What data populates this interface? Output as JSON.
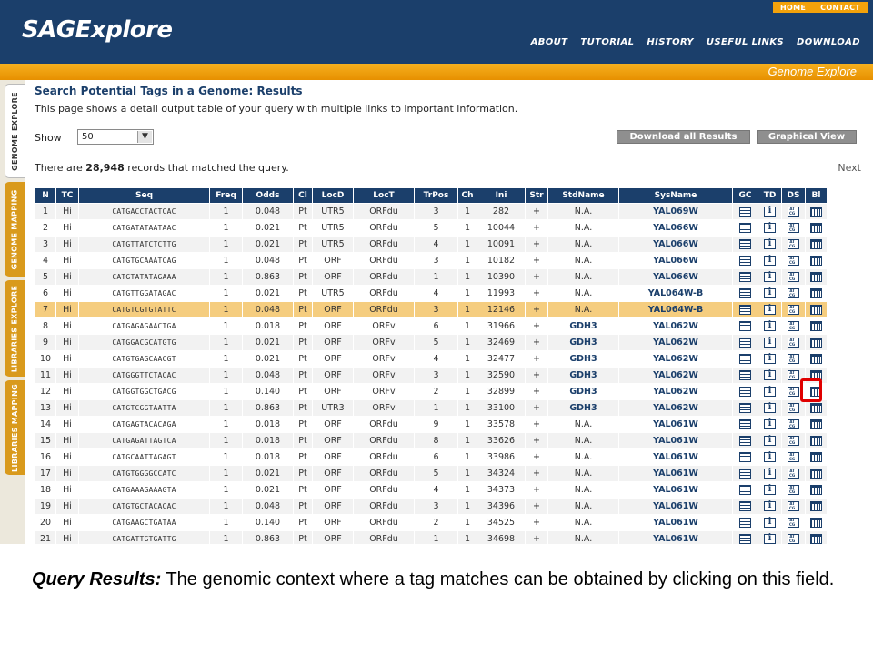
{
  "header": {
    "logo": "SAGExplore",
    "top_links": [
      "HOME",
      "CONTACT"
    ],
    "nav": [
      "ABOUT",
      "TUTORIAL",
      "HISTORY",
      "USEFUL LINKS",
      "DOWNLOAD"
    ],
    "section_title": "Genome Explore"
  },
  "sidebar": {
    "tabs": [
      {
        "label": "GENOME EXPLORE",
        "active": true
      },
      {
        "label": "GENOME MAPPING",
        "active": false
      },
      {
        "label": "LIBRARIES EXPLORE",
        "active": false
      },
      {
        "label": "LIBRARIES MAPPING",
        "active": false
      }
    ]
  },
  "main": {
    "title": "Search Potential Tags in a Genome: Results",
    "description": "This page shows a detail output table of your query with multiple links to important information.",
    "show_label": "Show",
    "show_value": "50",
    "download_button": "Download all Results",
    "graphical_button": "Graphical View",
    "records_prefix": "There are ",
    "records_count": "28,948",
    "records_suffix": " records that matched the query.",
    "next_label": "Next"
  },
  "table": {
    "columns": [
      "N",
      "TC",
      "Seq",
      "Freq",
      "Odds",
      "Cl",
      "LocD",
      "LocT",
      "TrPos",
      "Ch",
      "Ini",
      "Str",
      "StdName",
      "SysName",
      "GC",
      "TD",
      "DS",
      "Bl"
    ],
    "rows": [
      [
        "1",
        "Hi",
        "CATGACCTACTCAC",
        "1",
        "0.048",
        "Pt",
        "UTR5",
        "ORFdu",
        "3",
        "1",
        "282",
        "+",
        "N.A.",
        "YAL069W"
      ],
      [
        "2",
        "Hi",
        "CATGATATAATAAC",
        "1",
        "0.021",
        "Pt",
        "UTR5",
        "ORFdu",
        "5",
        "1",
        "10044",
        "+",
        "N.A.",
        "YAL066W"
      ],
      [
        "3",
        "Hi",
        "CATGTTATCTCTTG",
        "1",
        "0.021",
        "Pt",
        "UTR5",
        "ORFdu",
        "4",
        "1",
        "10091",
        "+",
        "N.A.",
        "YAL066W"
      ],
      [
        "4",
        "Hi",
        "CATGTGCAAATCAG",
        "1",
        "0.048",
        "Pt",
        "ORF",
        "ORFdu",
        "3",
        "1",
        "10182",
        "+",
        "N.A.",
        "YAL066W"
      ],
      [
        "5",
        "Hi",
        "CATGTATATAGAAA",
        "1",
        "0.863",
        "Pt",
        "ORF",
        "ORFdu",
        "1",
        "1",
        "10390",
        "+",
        "N.A.",
        "YAL066W"
      ],
      [
        "6",
        "Hi",
        "CATGTTGGATAGAC",
        "1",
        "0.021",
        "Pt",
        "UTR5",
        "ORFdu",
        "4",
        "1",
        "11993",
        "+",
        "N.A.",
        "YAL064W-B"
      ],
      [
        "7",
        "Hi",
        "CATGTCGTGTATTC",
        "1",
        "0.048",
        "Pt",
        "ORF",
        "ORFdu",
        "3",
        "1",
        "12146",
        "+",
        "N.A.",
        "YAL064W-B"
      ],
      [
        "8",
        "Hi",
        "CATGAGAGAACTGA",
        "1",
        "0.018",
        "Pt",
        "ORF",
        "ORFv",
        "6",
        "1",
        "31966",
        "+",
        "GDH3",
        "YAL062W"
      ],
      [
        "9",
        "Hi",
        "CATGGACGCATGTG",
        "1",
        "0.021",
        "Pt",
        "ORF",
        "ORFv",
        "5",
        "1",
        "32469",
        "+",
        "GDH3",
        "YAL062W"
      ],
      [
        "10",
        "Hi",
        "CATGTGAGCAACGT",
        "1",
        "0.021",
        "Pt",
        "ORF",
        "ORFv",
        "4",
        "1",
        "32477",
        "+",
        "GDH3",
        "YAL062W"
      ],
      [
        "11",
        "Hi",
        "CATGGGTTCTACAC",
        "1",
        "0.048",
        "Pt",
        "ORF",
        "ORFv",
        "3",
        "1",
        "32590",
        "+",
        "GDH3",
        "YAL062W"
      ],
      [
        "12",
        "Hi",
        "CATGGTGGCTGACG",
        "1",
        "0.140",
        "Pt",
        "ORF",
        "ORFv",
        "2",
        "1",
        "32899",
        "+",
        "GDH3",
        "YAL062W"
      ],
      [
        "13",
        "Hi",
        "CATGTCGGTAATTA",
        "1",
        "0.863",
        "Pt",
        "UTR3",
        "ORFv",
        "1",
        "1",
        "33100",
        "+",
        "GDH3",
        "YAL062W"
      ],
      [
        "14",
        "Hi",
        "CATGAGTACACAGA",
        "1",
        "0.018",
        "Pt",
        "ORF",
        "ORFdu",
        "9",
        "1",
        "33578",
        "+",
        "N.A.",
        "YAL061W"
      ],
      [
        "15",
        "Hi",
        "CATGAGATTAGTCA",
        "1",
        "0.018",
        "Pt",
        "ORF",
        "ORFdu",
        "8",
        "1",
        "33626",
        "+",
        "N.A.",
        "YAL061W"
      ],
      [
        "16",
        "Hi",
        "CATGCAATTAGAGT",
        "1",
        "0.018",
        "Pt",
        "ORF",
        "ORFdu",
        "6",
        "1",
        "33986",
        "+",
        "N.A.",
        "YAL061W"
      ],
      [
        "17",
        "Hi",
        "CATGTGGGGCCATC",
        "1",
        "0.021",
        "Pt",
        "ORF",
        "ORFdu",
        "5",
        "1",
        "34324",
        "+",
        "N.A.",
        "YAL061W"
      ],
      [
        "18",
        "Hi",
        "CATGAAAGAAAGTA",
        "1",
        "0.021",
        "Pt",
        "ORF",
        "ORFdu",
        "4",
        "1",
        "34373",
        "+",
        "N.A.",
        "YAL061W"
      ],
      [
        "19",
        "Hi",
        "CATGTGCTACACAC",
        "1",
        "0.048",
        "Pt",
        "ORF",
        "ORFdu",
        "3",
        "1",
        "34396",
        "+",
        "N.A.",
        "YAL061W"
      ],
      [
        "20",
        "Hi",
        "CATGAAGCTGATAA",
        "1",
        "0.140",
        "Pt",
        "ORF",
        "ORFdu",
        "2",
        "1",
        "34525",
        "+",
        "N.A.",
        "YAL061W"
      ],
      [
        "21",
        "Hi",
        "CATGATTGTGATTG",
        "1",
        "0.863",
        "Pt",
        "ORF",
        "ORFdu",
        "1",
        "1",
        "34698",
        "+",
        "N.A.",
        "YAL061W"
      ]
    ],
    "highlighted_row": "7",
    "row_icons": [
      "gc-icon",
      "td-info-icon",
      "ds-sequence-icon",
      "bl-blast-icon"
    ]
  },
  "caption": {
    "label": "Query Results:",
    "text": " The genomic context where a tag matches can be obtained by clicking on this field."
  },
  "colors": {
    "header_blue": "#1b3f6b",
    "orange": "#f3a20b",
    "highlight_row": "#f5cd7f",
    "callout_red": "#e00000"
  }
}
